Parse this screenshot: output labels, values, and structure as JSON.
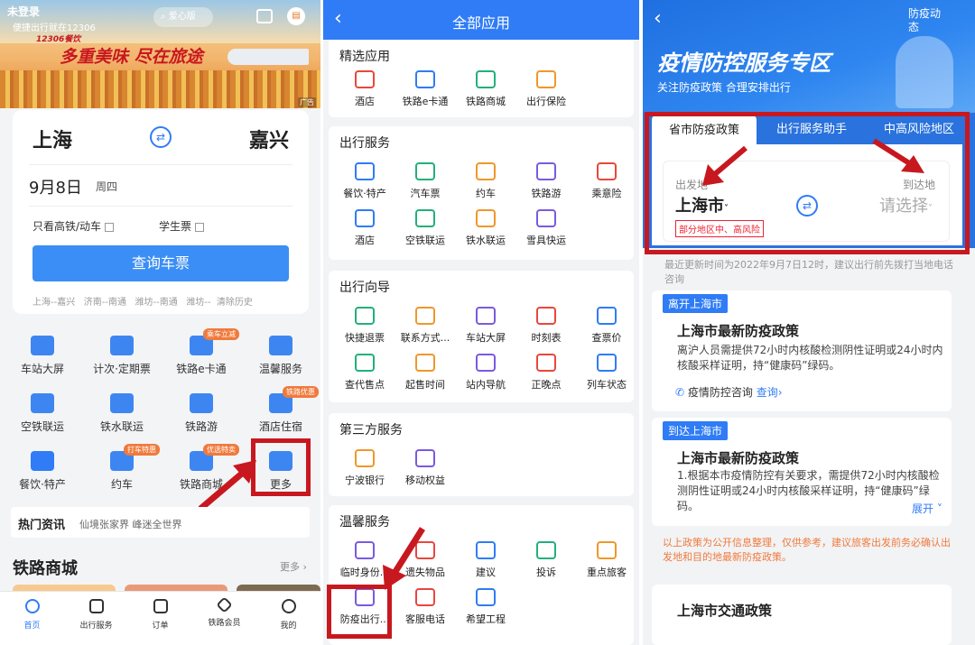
{
  "panel1": {
    "login_status": "未登录",
    "login_hint": "便捷出行就在12306",
    "search_label": "爱心版",
    "banner_sub": "12306餐饮",
    "banner_title": "多重美味 尽在旅途",
    "ad_label": "广告",
    "from_city": "上海",
    "to_city": "嘉兴",
    "date": "9月8日",
    "weekday": "周四",
    "opt_highspeed": "只看高铁/动车",
    "opt_student": "学生票",
    "query_button": "查询车票",
    "history": [
      "上海--嘉兴",
      "济南--南通",
      "潍坊--南通",
      "潍坊--"
    ],
    "clear_history": "清除历史",
    "grid": [
      {
        "label": "车站大屏",
        "icon": "station-screen-icon",
        "tag": ""
      },
      {
        "label": "计次·定期票",
        "icon": "ticket-card-icon",
        "tag": ""
      },
      {
        "label": "铁路e卡通",
        "icon": "e-card-icon",
        "tag": "乘车立减"
      },
      {
        "label": "温馨服务",
        "icon": "heart-service-icon",
        "tag": ""
      },
      {
        "label": "空铁联运",
        "icon": "air-rail-icon",
        "tag": ""
      },
      {
        "label": "铁水联运",
        "icon": "ship-rail-icon",
        "tag": ""
      },
      {
        "label": "铁路游",
        "icon": "mountain-travel-icon",
        "tag": ""
      },
      {
        "label": "酒店住宿",
        "icon": "hotel-icon",
        "tag": "铁路优惠"
      },
      {
        "label": "餐饮·特产",
        "icon": "fork-knife-icon",
        "tag": ""
      },
      {
        "label": "约车",
        "icon": "car-icon",
        "tag": "打车特惠"
      },
      {
        "label": "铁路商城",
        "icon": "cart-icon",
        "tag": "优选特卖"
      },
      {
        "label": "更多",
        "icon": "more-grid-icon",
        "tag": ""
      }
    ],
    "news_title": "热门资讯",
    "news_text": "仙境张家界 峰迷全世界",
    "mall_title": "铁路商城",
    "mall_more": "更多",
    "tabs": [
      "首页",
      "出行服务",
      "订单",
      "铁路会员",
      "我的"
    ]
  },
  "panel2": {
    "title": "全部应用",
    "sections": [
      {
        "title": "精选应用",
        "apps": [
          "酒店",
          "铁路e卡通",
          "铁路商城",
          "出行保险"
        ]
      },
      {
        "title": "出行服务",
        "apps": [
          "餐饮·特产",
          "汽车票",
          "约车",
          "铁路游",
          "乘意险",
          "酒店",
          "空铁联运",
          "铁水联运",
          "雪具快运"
        ]
      },
      {
        "title": "出行向导",
        "apps": [
          "快捷退票",
          "联系方式...",
          "车站大屏",
          "时刻表",
          "查票价",
          "查代售点",
          "起售时间",
          "站内导航",
          "正晚点",
          "列车状态"
        ]
      },
      {
        "title": "第三方服务",
        "apps": [
          "宁波银行",
          "移动权益"
        ]
      },
      {
        "title": "温馨服务",
        "apps": [
          "临时身份...",
          "遗失物品",
          "建议",
          "投诉",
          "重点旅客",
          "防疫出行...",
          "客服电话",
          "希望工程"
        ]
      }
    ]
  },
  "panel3": {
    "corner": "防疫动态",
    "hero_title": "疫情防控服务专区",
    "hero_sub": "关注防疫政策 合理安排出行",
    "tabs": [
      "省市防疫政策",
      "出行服务助手",
      "中高风险地区"
    ],
    "depart_label": "出发地",
    "arrive_label": "到达地",
    "depart_city": "上海市",
    "arrive_city": "请选择",
    "risk_tag": "部分地区中、高风险",
    "update_note": "最近更新时间为2022年9月7日12时，建议出行前先拨打当地电话咨询",
    "leave_pill": "离开上海市",
    "leave_title": "上海市最新防疫政策",
    "leave_body": "离沪人员需提供72小时内核酸检测阴性证明或24小时内核酸采样证明，持“健康码”绿码。",
    "consult_label": "疫情防控咨询",
    "consult_link": "查询",
    "arrive_pill": "到达上海市",
    "arrive_title": "上海市最新防疫政策",
    "arrive_body": "1.根据本市疫情防控有关要求，需提供72小时内核酸检测阴性证明或24小时内核酸采样证明，持“健康码”绿码。",
    "expand": "展开",
    "disclaimer": "以上政策为公开信息整理，仅供参考，建议旅客出发前务必确认出发地和目的地最新防疫政策。",
    "traffic_title": "上海市交通政策"
  },
  "colors": {
    "primary": "#2f7cf6",
    "highlight": "#c8181f",
    "orange": "#f07a3c"
  }
}
